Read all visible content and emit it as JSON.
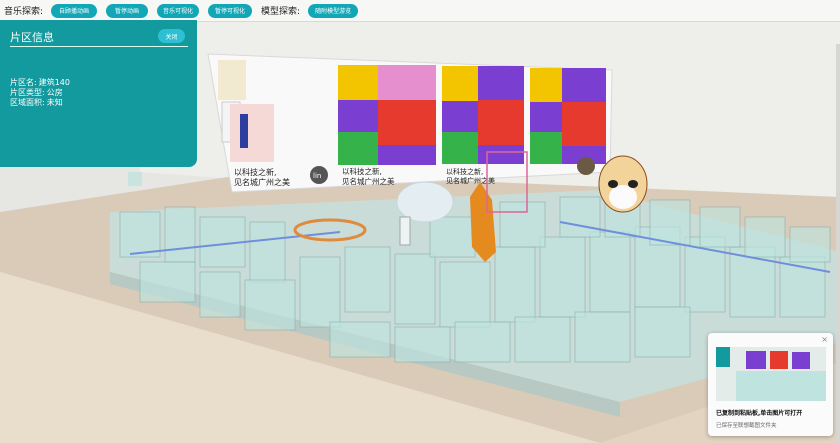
{
  "toolbar": {
    "music_label": "音乐探索:",
    "model_label": "模型探索:",
    "buttons": [
      "自顾播动画",
      "暂停动画",
      "音乐可视化",
      "暂停可视化",
      "随附模型游览"
    ]
  },
  "info_panel": {
    "title": "片区信息",
    "close_label": "关闭",
    "rows": [
      {
        "key": "片区名:",
        "value": "建筑140"
      },
      {
        "key": "片区类型:",
        "value": "公房"
      },
      {
        "key": "区域面积:",
        "value": "未知"
      }
    ]
  },
  "scene": {
    "banner_texts": [
      "以科技之新,",
      "见名城广州之美",
      "以科技之新,",
      "见名城广州之美",
      "以科技之新,",
      "见名城广州之美"
    ],
    "badge_label": "lin"
  },
  "toast": {
    "message": "已复制到粘贴板,单击图片可打开",
    "sub": "已保存至联想截图文件夹",
    "close": "×"
  },
  "colors": {
    "accent": "#12a7b6",
    "panel": "#129a9e"
  }
}
